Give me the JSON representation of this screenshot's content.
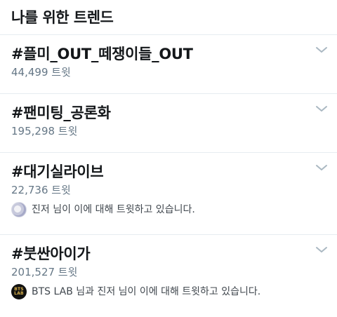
{
  "header": {
    "title": "나를 위한 트렌드"
  },
  "trends": [
    {
      "name": "#플미_OUT_떼쟁이들_OUT",
      "count": "44,499 트윗"
    },
    {
      "name": "#팬미팅_공론화",
      "count": "195,298 트윗"
    },
    {
      "name": "#대기실라이브",
      "count": "22,736 트윗",
      "context": {
        "text": "진저 님이 이에 대해 트윗하고 있습니다.",
        "avatar": "anime-avatar"
      }
    },
    {
      "name": "#붓싼아이가",
      "count": "201,527 트윗",
      "context": {
        "text": "BTS LAB 님과 진저 님이 이에 대해 트윗하고 있습니다.",
        "avatar": "bts-lab-avatar",
        "avatar_label": [
          "BTS",
          "LAB"
        ]
      }
    }
  ],
  "icons": {
    "chevron": "chevron-down-icon"
  },
  "colors": {
    "primary_text": "#14171a",
    "secondary_text": "#657786",
    "divider": "#e6ecf0",
    "chevron": "#aab8c2"
  }
}
